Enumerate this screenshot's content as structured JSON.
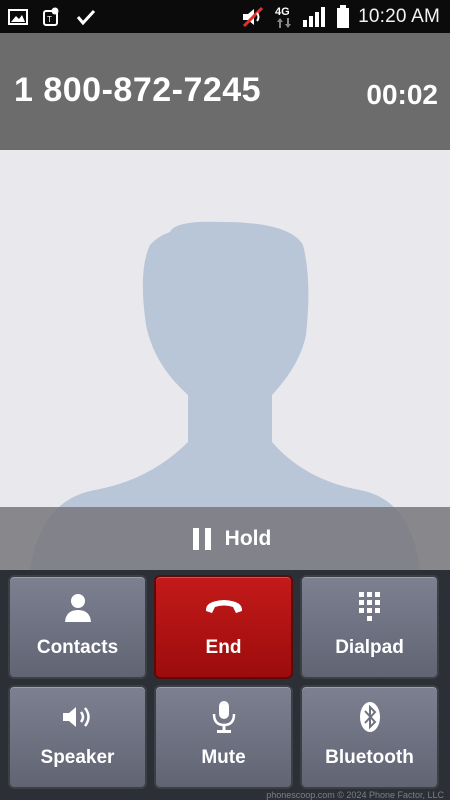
{
  "status_bar": {
    "time": "10:20 AM",
    "network": "4G",
    "icons": [
      "gallery-icon",
      "tmobile-app-icon",
      "checkmark-icon",
      "mute-sound-icon",
      "signal-icon",
      "battery-icon"
    ]
  },
  "call": {
    "number": "1 800-872-7245",
    "timer": "00:02"
  },
  "hold": {
    "label": "Hold"
  },
  "buttons": {
    "contacts": {
      "label": "Contacts",
      "icon": "person-icon"
    },
    "end": {
      "label": "End",
      "icon": "hangup-icon",
      "color": "#b41414"
    },
    "dialpad": {
      "label": "Dialpad",
      "icon": "dialpad-icon"
    },
    "speaker": {
      "label": "Speaker",
      "icon": "speaker-icon"
    },
    "mute": {
      "label": "Mute",
      "icon": "microphone-mute-icon"
    },
    "bluetooth": {
      "label": "Bluetooth",
      "icon": "bluetooth-icon"
    }
  },
  "footer": {
    "credit": "phonescoop.com  © 2024 Phone Factor, LLC"
  },
  "colors": {
    "header_bg": "#6c6c6c",
    "status_bg": "#0b0b0b",
    "silhouette": "#b9c6d8",
    "button_bg": "#6f7281"
  }
}
